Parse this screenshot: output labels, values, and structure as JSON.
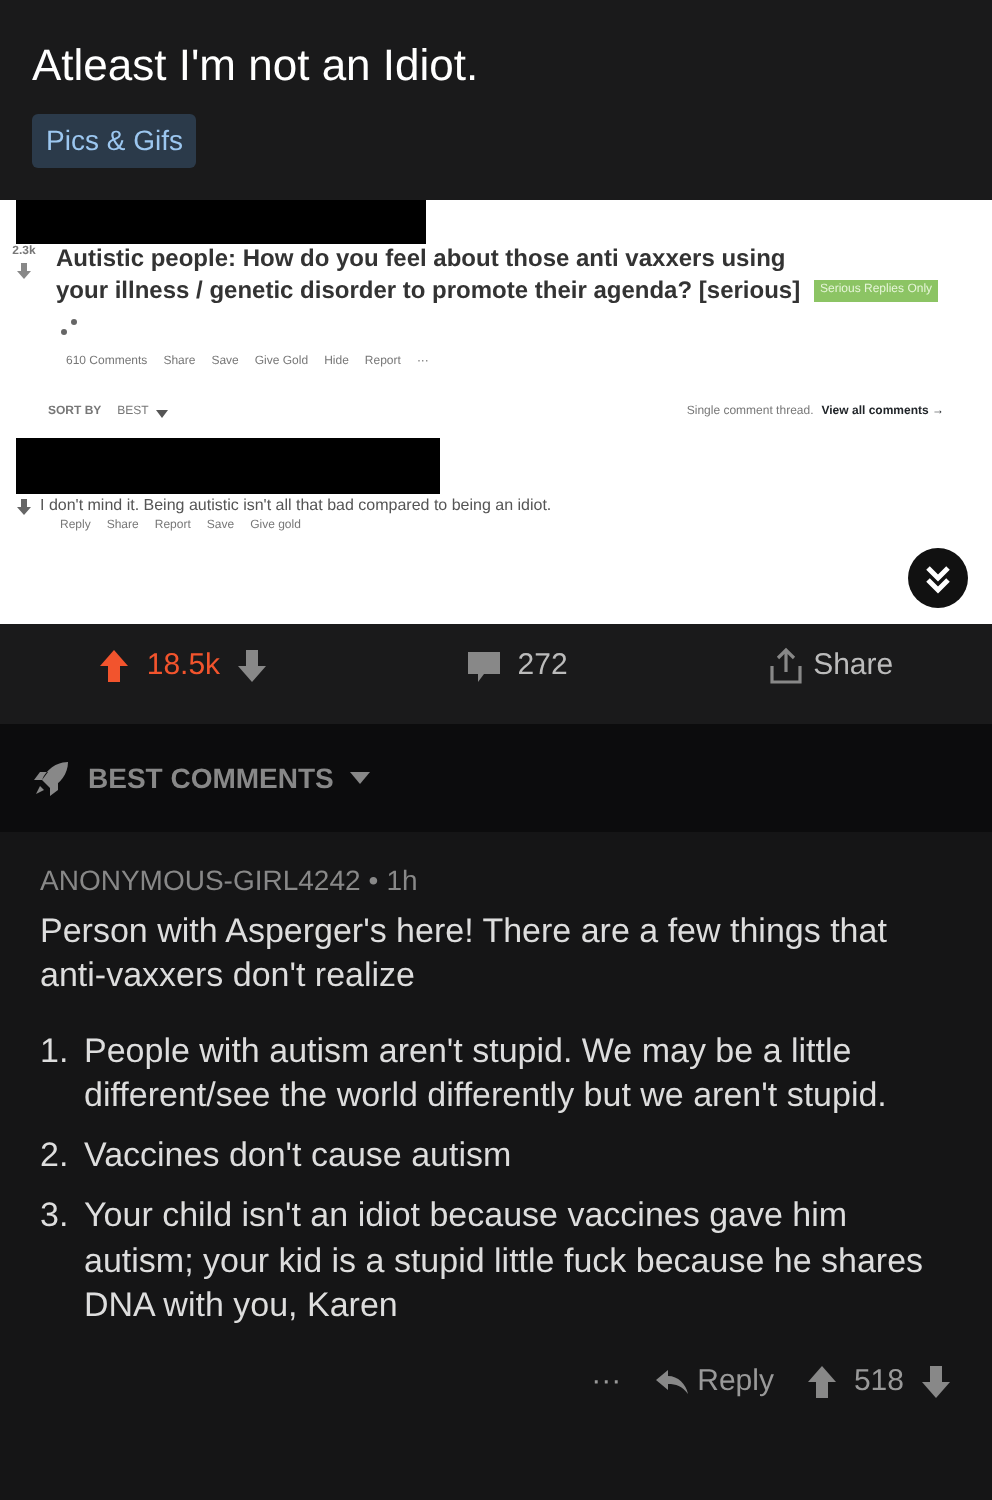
{
  "post": {
    "title": "Atleast I'm not an Idiot.",
    "flair": "Pics & Gifs"
  },
  "embedded": {
    "score": "2.3k",
    "title": "Autistic people: How do you feel about those anti vaxxers using your illness / genetic disorder to promote their agenda? [serious]",
    "tag": "Serious Replies Only",
    "actions": [
      "610 Comments",
      "Share",
      "Save",
      "Give Gold",
      "Hide",
      "Report",
      "···"
    ],
    "sort_label": "SORT BY",
    "sort_value": "BEST",
    "thread_note": "Single comment thread.",
    "view_all": "View all comments →",
    "comment": "I don't mind it. Being autistic isn't all that bad compared to being an idiot.",
    "comment_actions": [
      "Reply",
      "Share",
      "Report",
      "Save",
      "Give gold"
    ]
  },
  "post_bar": {
    "score": "18.5k",
    "upvoted": true,
    "comments": "272",
    "share": "Share"
  },
  "sort": {
    "label": "BEST COMMENTS"
  },
  "top_comment": {
    "author": "ANONYMOUS-GIRL4242",
    "separator": "•",
    "time": "1h",
    "intro": "Person with Asperger's here! There are a few things that anti-vaxxers don't realize",
    "points": [
      {
        "num": "1.",
        "text": "People with autism aren't stupid. We may be a little different/see the world differently but we aren't stupid."
      },
      {
        "num": "2.",
        "text": "Vaccines don't cause autism"
      },
      {
        "num": "3.",
        "text": "Your child isn't an idiot because vaccines gave him autism; your kid is a stupid little fuck because he shares DNA with you, Karen"
      }
    ],
    "more": "···",
    "reply": "Reply",
    "score": "518"
  }
}
